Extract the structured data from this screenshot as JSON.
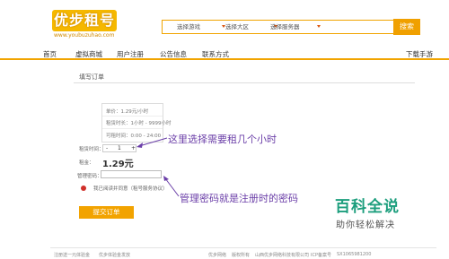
{
  "logo": {
    "text": "优步租号",
    "url": "www.youbuzuhao.com"
  },
  "search": {
    "selects": [
      "选择游戏",
      "选择大区",
      "选择服务器"
    ],
    "button": "搜索"
  },
  "nav": {
    "items": [
      "首页",
      "虚拟商城",
      "用户注册",
      "公告信息",
      "联系方式"
    ],
    "download": "下载手游"
  },
  "order": {
    "title": "填写订单",
    "price_per_hour": "单价：1.29元/小时",
    "rent_duration": "租赁时长：1小时 - 9999小时",
    "rent_time": "可租时间：0:00 - 24:00",
    "hours_label": "租赁时间：",
    "hours_value": "1",
    "minus": "-",
    "plus": "+",
    "amount_label": "租金：",
    "amount": "1.29元",
    "password_label": "管理密码：",
    "password_value": "",
    "agreement": "我已阅读并同意（租号服务协议）",
    "submit": "提交订单"
  },
  "annotations": {
    "hours_note": "这里选择需要租几个小时",
    "password_note": "管理密码就是注册时的密码"
  },
  "footer": {
    "left1": "注册送一元体验金",
    "left2": "优步体验金发放",
    "right1": "优步网络",
    "right2": "版权所有",
    "right3": "山西优步网络科技有限公司",
    "right4": "ICP备案号",
    "right5": "SX1065981200"
  },
  "watermark": {
    "title": "百科全说",
    "subtitle": "助你轻松解决"
  },
  "colors": {
    "accent": "#f1a400",
    "annotation": "#6b3fa8",
    "watermark": "#1c9e7d"
  }
}
